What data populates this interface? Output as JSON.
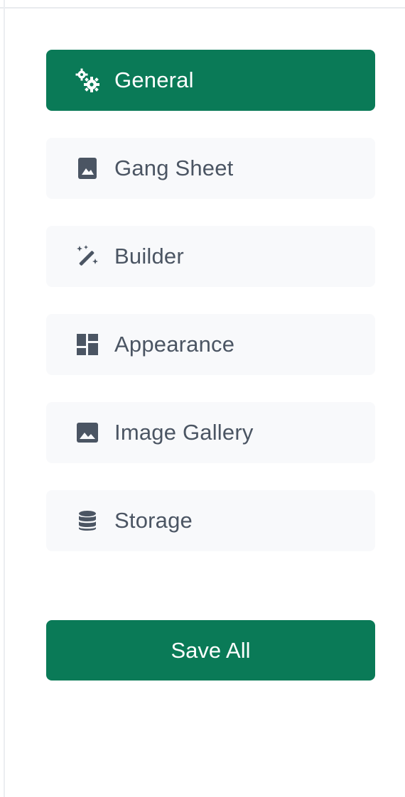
{
  "colors": {
    "accent": "#0a7a57",
    "item_bg": "#f8f9fb",
    "item_text": "#4b5563",
    "active_text": "#ffffff"
  },
  "nav": {
    "items": [
      {
        "label": "General",
        "icon": "gears-icon",
        "active": true
      },
      {
        "label": "Gang Sheet",
        "icon": "portrait-image-icon",
        "active": false
      },
      {
        "label": "Builder",
        "icon": "magic-wand-icon",
        "active": false
      },
      {
        "label": "Appearance",
        "icon": "dashboard-layout-icon",
        "active": false
      },
      {
        "label": "Image Gallery",
        "icon": "image-icon",
        "active": false
      },
      {
        "label": "Storage",
        "icon": "database-icon",
        "active": false
      }
    ]
  },
  "actions": {
    "save_label": "Save All"
  }
}
